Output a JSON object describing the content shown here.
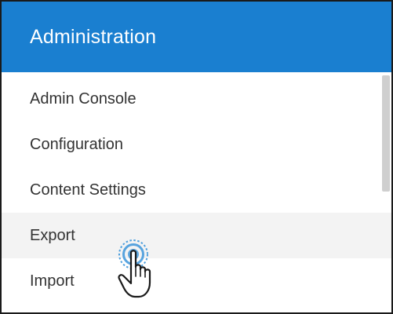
{
  "header": {
    "title": "Administration"
  },
  "menu": {
    "items": [
      {
        "label": "Admin Console"
      },
      {
        "label": "Configuration"
      },
      {
        "label": "Content Settings"
      },
      {
        "label": "Export"
      },
      {
        "label": "Import"
      }
    ],
    "hovered_item": "Export"
  },
  "colors": {
    "header_bg": "#1a7fd0",
    "header_text": "#ffffff",
    "item_text": "#333333",
    "hover_bg": "#f3f3f3",
    "click_ring": "#2f8fd8"
  },
  "icons": {
    "cursor": "hand-pointer-icon",
    "click": "click-ripple-icon"
  }
}
